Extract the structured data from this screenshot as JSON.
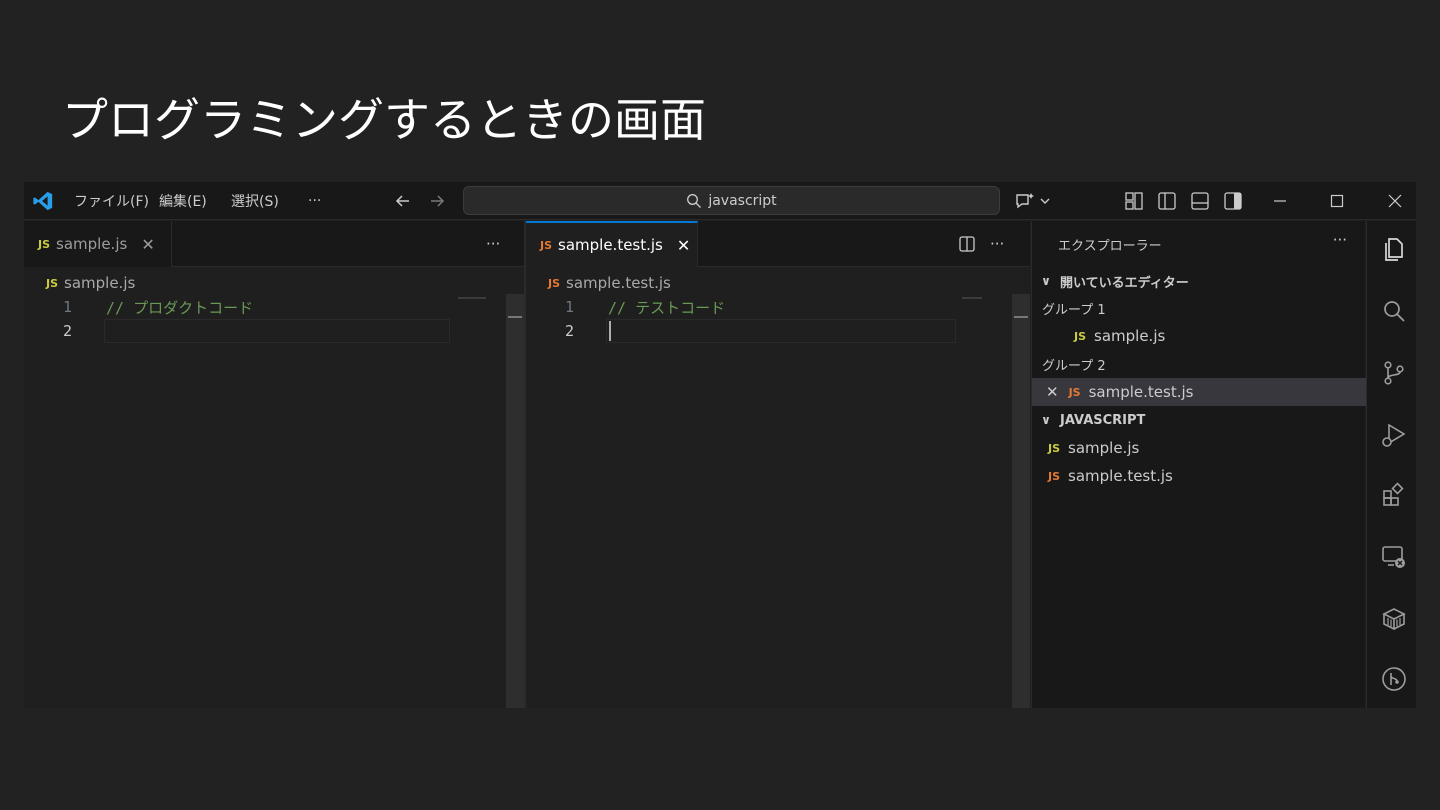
{
  "slide": {
    "title": "プログラミングするときの画面"
  },
  "titlebar": {
    "menu": {
      "file": "ファイル(F)",
      "edit": "編集(E)",
      "selection": "選択(S)",
      "more": "···"
    },
    "search": {
      "text": "javascript"
    }
  },
  "editor_left": {
    "tab": {
      "icon": "JS",
      "label": "sample.js"
    },
    "more": "···",
    "breadcrumb": {
      "icon": "JS",
      "label": "sample.js"
    },
    "lines": [
      {
        "num": "1",
        "text": "// プロダクトコード"
      },
      {
        "num": "2",
        "text": ""
      }
    ]
  },
  "editor_right": {
    "tab": {
      "icon": "JS",
      "label": "sample.test.js"
    },
    "more": "···",
    "breadcrumb": {
      "icon": "JS",
      "label": "sample.test.js"
    },
    "lines": [
      {
        "num": "1",
        "text": "// テストコード"
      },
      {
        "num": "2",
        "text": ""
      }
    ]
  },
  "explorer": {
    "title": "エクスプローラー",
    "more": "···",
    "open_editors": {
      "label": "開いているエディター",
      "group1": {
        "label": "グループ 1",
        "file": {
          "icon": "JS",
          "label": "sample.js"
        }
      },
      "group2": {
        "label": "グループ 2",
        "file": {
          "icon": "JS",
          "label": "sample.test.js"
        }
      }
    },
    "folder": {
      "label": "JAVASCRIPT",
      "files": [
        {
          "icon": "JS",
          "label": "sample.js"
        },
        {
          "icon": "JS",
          "label": "sample.test.js"
        }
      ]
    }
  },
  "colors": {
    "background": "#222222",
    "editor_bg": "#1f1f1f",
    "accent": "#0078d4",
    "js_yellow": "#cbcb41",
    "js_orange": "#e37933",
    "comment": "#6a9955"
  },
  "icons": {
    "titlebar": [
      "vscode-logo-icon",
      "arrow-left-icon",
      "arrow-right-icon",
      "search-icon",
      "copilot-icon",
      "chevron-down-icon",
      "customize-layout-icon",
      "toggle-primary-sidebar-icon",
      "toggle-panel-icon",
      "toggle-secondary-sidebar-icon",
      "minimize-icon",
      "maximize-icon",
      "close-icon"
    ],
    "activity": [
      "explorer-icon",
      "search-icon",
      "source-control-icon",
      "run-debug-icon",
      "extensions-icon",
      "remote-explorer-icon",
      "containers-icon",
      "git-graph-icon"
    ]
  }
}
